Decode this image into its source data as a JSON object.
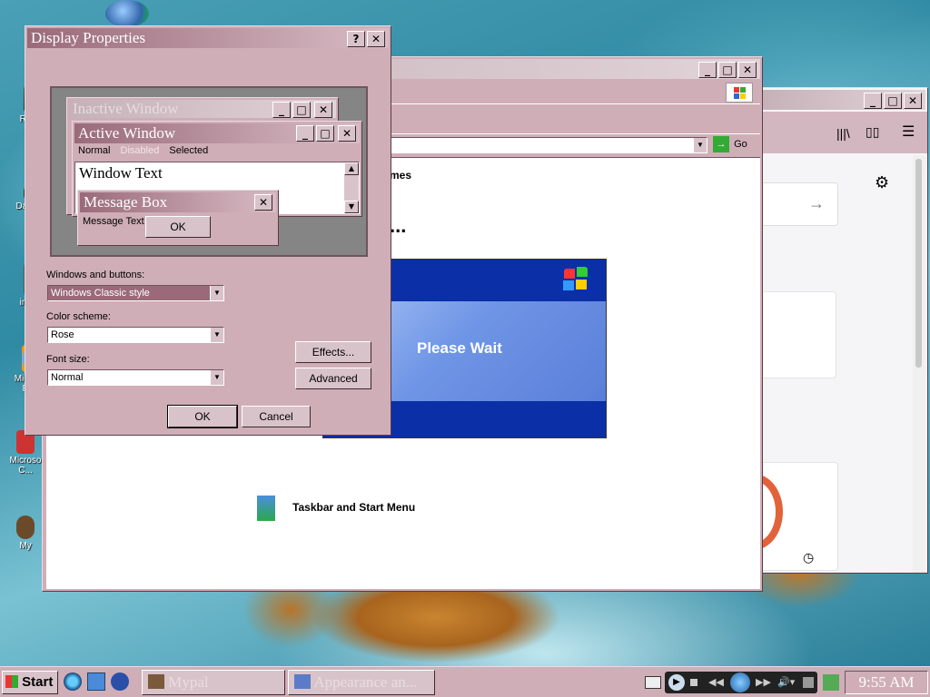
{
  "colors": {
    "accent": "#9a6a7a",
    "face": "#cfaeb8",
    "xp_blue": "#0b2fa6"
  },
  "desktop": {
    "icons": [
      {
        "label": "Re",
        "icon": "recycle-bin-icon"
      },
      {
        "label": "Data",
        "icon": "data-icon"
      },
      {
        "label": "ins",
        "icon": "installer-icon"
      },
      {
        "label": "Micro\nE",
        "icon": "ie-shortcut-icon"
      },
      {
        "label": "Microso\nC...",
        "icon": "shortcut-icon"
      },
      {
        "label": "My",
        "icon": "my-computer-icon"
      }
    ]
  },
  "explorer": {
    "go_label": "Go",
    "items": [
      "mes",
      "Taskbar and Start Menu"
    ],
    "ellipsis": "..."
  },
  "splash": {
    "text": "Please Wait"
  },
  "display_properties": {
    "title": "Display Properties",
    "preview": {
      "inactive_title": "Inactive Window",
      "active_title": "Active Window",
      "menu": [
        "Normal",
        "Disabled",
        "Selected"
      ],
      "window_text": "Window Text",
      "message_box_title": "Message Box",
      "message_text": "Message Text",
      "ok_label": "OK"
    },
    "windows_buttons_label": "Windows and buttons:",
    "windows_buttons_value": "Windows Classic style",
    "color_scheme_label": "Color scheme:",
    "color_scheme_value": "Rose",
    "font_size_label": "Font size:",
    "font_size_value": "Normal",
    "effects_label": "Effects...",
    "advanced_label": "Advanced",
    "ok_label": "OK",
    "cancel_label": "Cancel"
  },
  "taskbar": {
    "start_label": "Start",
    "tasks": [
      {
        "label": "Mypal",
        "icon": "mypal-icon"
      },
      {
        "label": "Appearance an...",
        "icon": "appearance-icon"
      }
    ],
    "clock": "9:55 AM"
  }
}
